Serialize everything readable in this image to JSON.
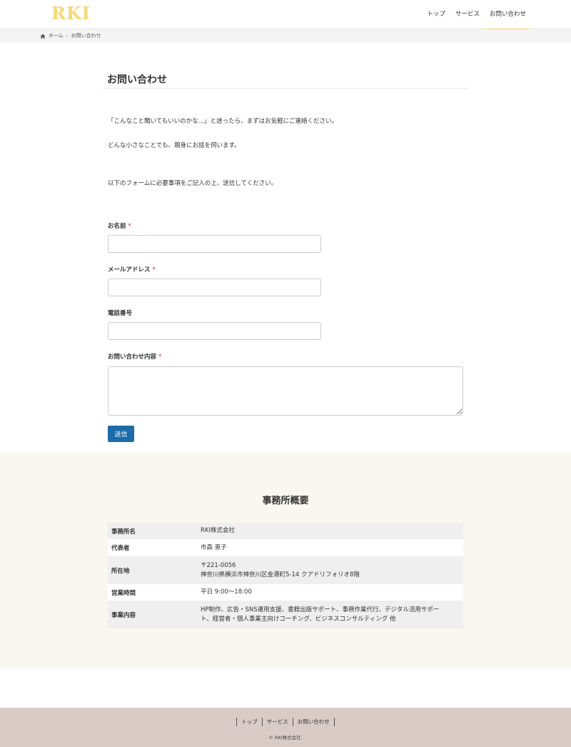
{
  "header": {
    "logo": "RKI",
    "nav": [
      {
        "label": "トップ"
      },
      {
        "label": "サービス"
      },
      {
        "label": "お問い合わせ"
      }
    ],
    "accent_color": "#f7d77a"
  },
  "breadcrumb": {
    "home": "ホーム",
    "current": "お問い合わせ"
  },
  "main": {
    "title": "お問い合わせ",
    "paragraphs": [
      "「こんなこと聞いてもいいのかな…」と迷ったら、まずはお気軽にご連絡ください。",
      "どんな小さなことでも、親身にお話を伺います。",
      "以下のフォームに必要事項をご記入の上、送信してください。"
    ],
    "form": {
      "name_label": "お名前",
      "email_label": "メールアドレス",
      "phone_label": "電話番号",
      "message_label": "お問い合わせ内容",
      "required_mark": "*",
      "name_value": "",
      "email_value": "",
      "phone_value": "",
      "message_value": "",
      "submit_label": "送信",
      "submit_color": "#1b6ca8"
    }
  },
  "company": {
    "title": "事務所概要",
    "rows": [
      {
        "label": "事務所名",
        "lines": [
          "RKI株式会社"
        ]
      },
      {
        "label": "代表者",
        "lines": [
          "市森 恵子"
        ]
      },
      {
        "label": "所在地",
        "lines": [
          "〒221-0056",
          "神奈川県横浜市神奈川区金港町5-14 クアドリフォリオ8階"
        ]
      },
      {
        "label": "営業時間",
        "lines": [
          "平日 9:00〜18:00"
        ]
      },
      {
        "label": "事業内容",
        "lines": [
          "HP制作、広告・SNS運用支援、書籍出版サポート、事務作業代行、デジタル活用サポー",
          "ト、経営者・個人事業主向けコーチング、ビジネスコンサルティング 他"
        ]
      }
    ]
  },
  "footer": {
    "links": [
      {
        "label": "トップ"
      },
      {
        "label": "サービス"
      },
      {
        "label": "お問い合わせ"
      }
    ],
    "copyright": "© RKI株式会社."
  }
}
